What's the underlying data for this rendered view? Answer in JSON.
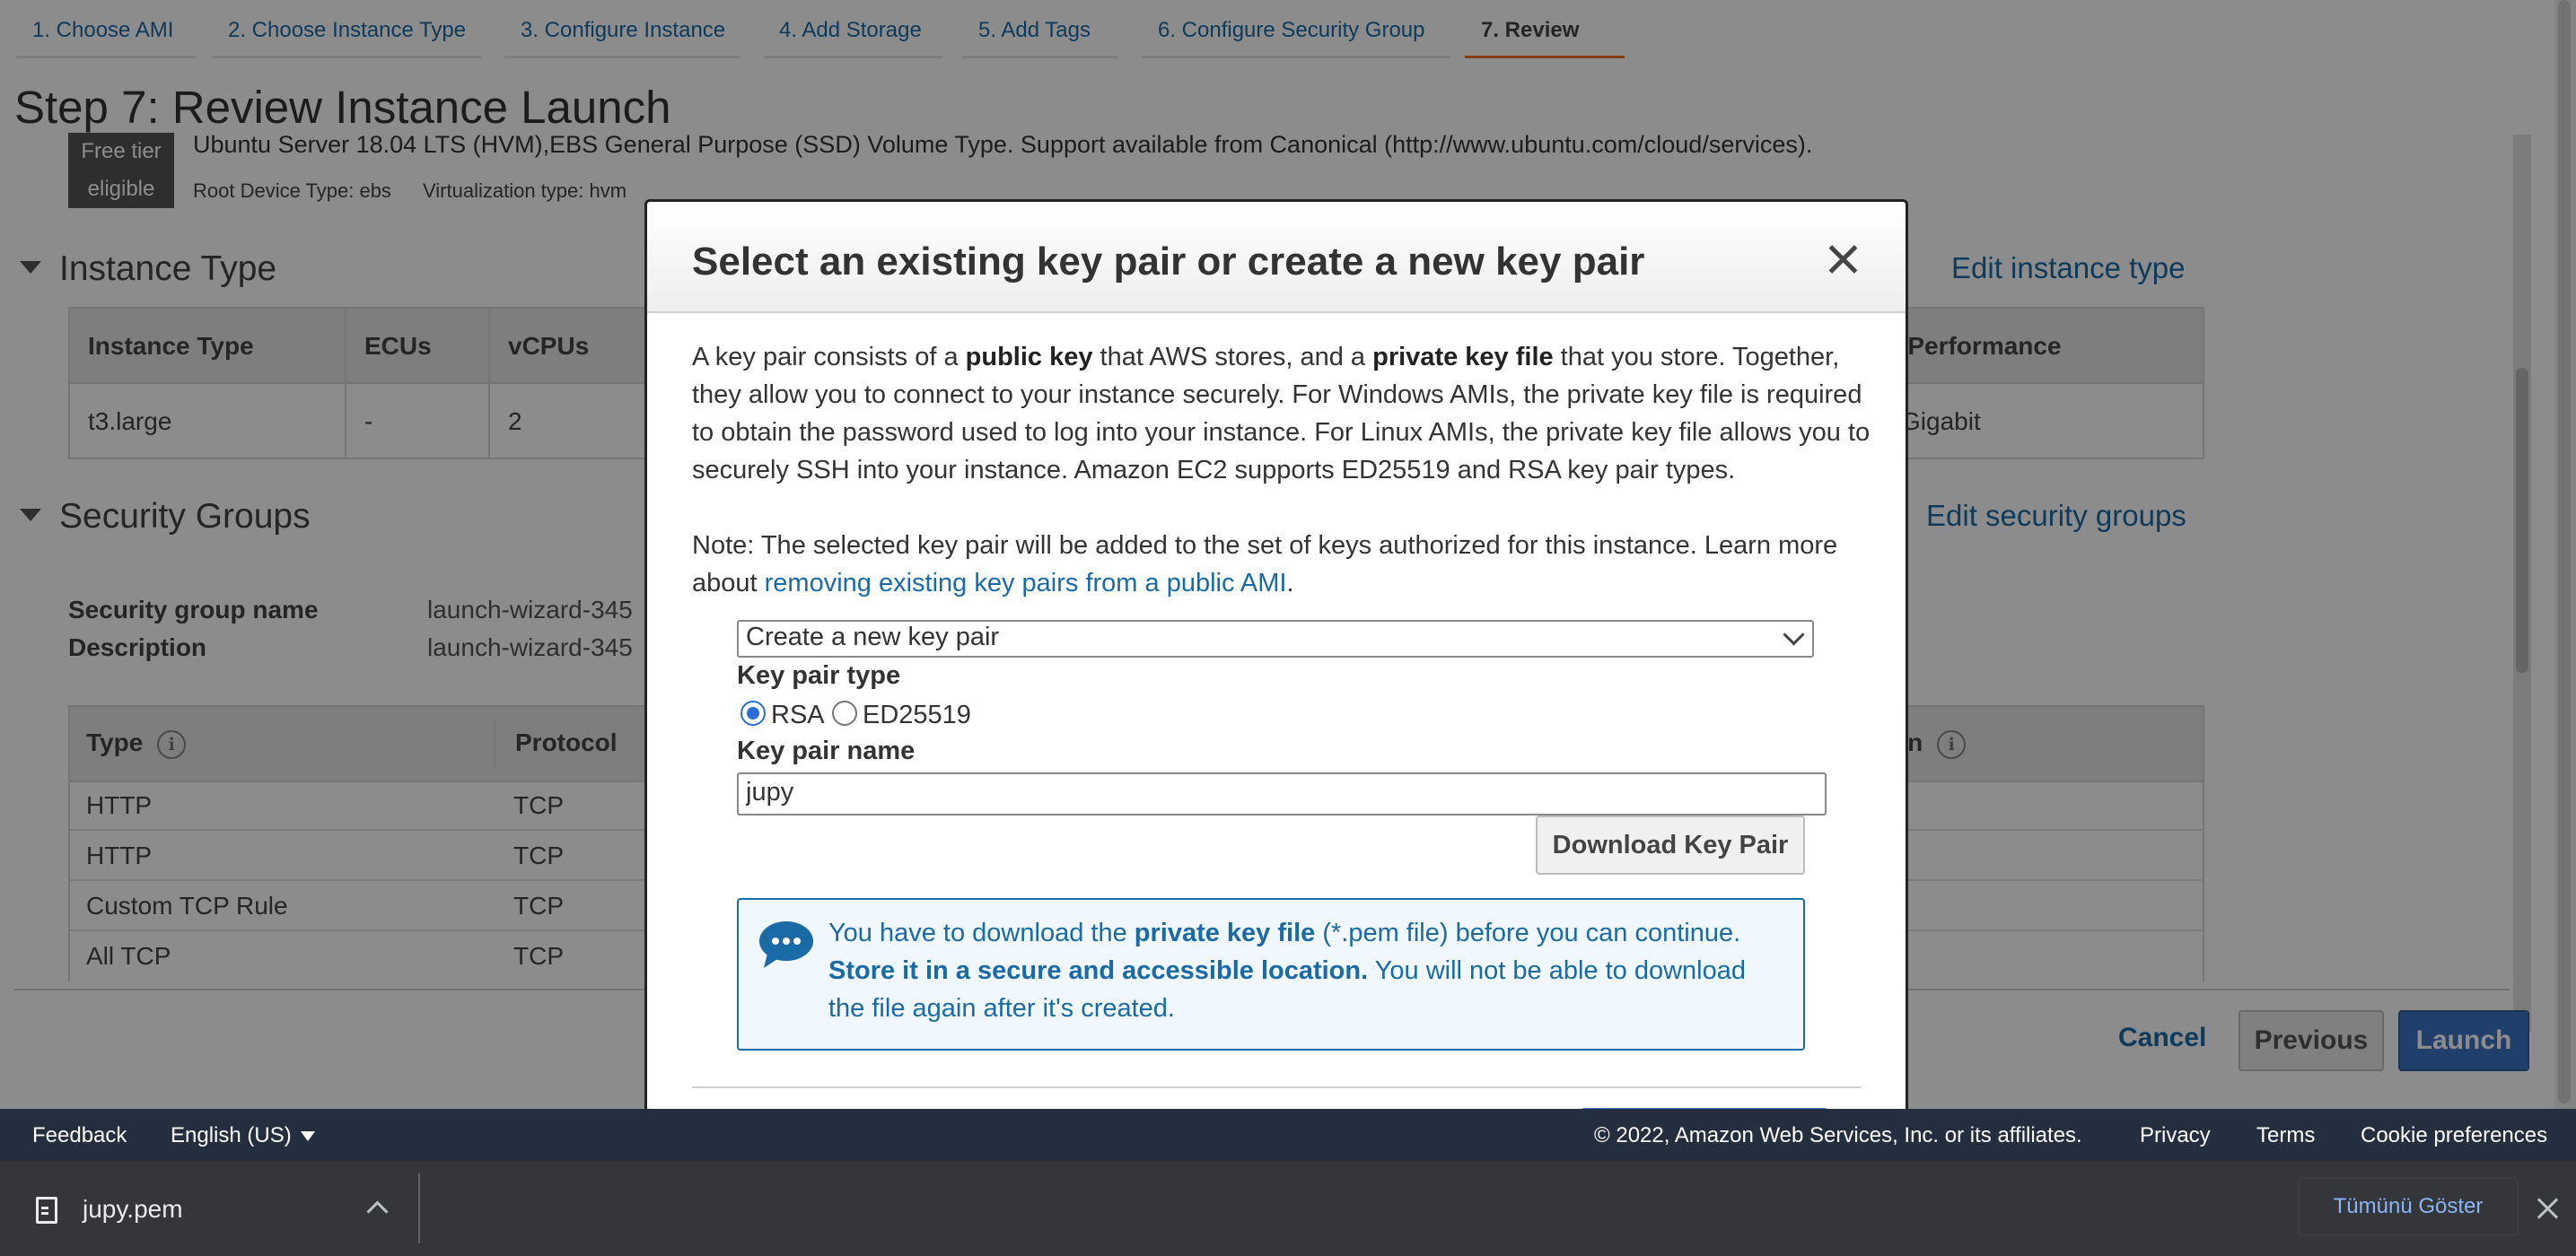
{
  "wizard": {
    "tabs": [
      {
        "label": "1. Choose AMI"
      },
      {
        "label": "2. Choose Instance Type"
      },
      {
        "label": "3. Configure Instance"
      },
      {
        "label": "4. Add Storage"
      },
      {
        "label": "5. Add Tags"
      },
      {
        "label": "6. Configure Security Group"
      },
      {
        "label": "7. Review"
      }
    ],
    "active_tab": "7. Review",
    "active_color": "#ec7211"
  },
  "page": {
    "title": "Step 7: Review Instance Launch",
    "ami": {
      "badge": [
        "Free tier",
        "eligible"
      ],
      "description": "Ubuntu Server 18.04 LTS (HVM),EBS General Purpose (SSD) Volume Type. Support available from Canonical (http://www.ubuntu.com/cloud/services).",
      "root_device": "Root Device Type: ebs",
      "virtualization": "Virtualization type: hvm"
    },
    "instance_type": {
      "heading": "Instance Type",
      "edit_link": "Edit instance type",
      "columns": [
        "Instance Type",
        "ECUs",
        "vCPUs",
        "k Performance"
      ],
      "row": [
        "t3.large",
        "-",
        "2",
        "Gigabit"
      ]
    },
    "security_groups": {
      "heading": "Security Groups",
      "edit_link": "Edit security groups",
      "name_key": "Security group name",
      "name_value": "launch-wizard-345",
      "desc_key": "Description",
      "desc_value": "launch-wizard-345",
      "columns": [
        "Type",
        "Protocol",
        "on"
      ],
      "rows": [
        [
          "HTTP",
          "TCP"
        ],
        [
          "HTTP",
          "TCP"
        ],
        [
          "Custom TCP Rule",
          "TCP"
        ],
        [
          "All TCP",
          "TCP"
        ]
      ]
    },
    "buttons": {
      "cancel": "Cancel",
      "previous": "Previous",
      "launch": "Launch"
    }
  },
  "modal": {
    "title": "Select an existing key pair or create a new key pair",
    "intro": {
      "p1": "A key pair consists of a ",
      "b1": "public key",
      "p2": " that AWS stores, and a ",
      "b2": "private key file",
      "p3": " that you store. Together, they allow you to connect to your instance securely. For Windows AMIs, the private key file is required to obtain the password used to log into your instance. For Linux AMIs, the private key file allows you to securely SSH into your instance. Amazon EC2 supports ED25519 and RSA key pair types."
    },
    "note": {
      "text": "Note: The selected key pair will be added to the set of keys authorized for this instance. Learn more about ",
      "link": "removing existing key pairs from a public AMI",
      "end": "."
    },
    "select_value": "Create a new key pair",
    "key_pair_type_label": "Key pair type",
    "radio_rsa": "RSA",
    "radio_ed": "ED25519",
    "key_pair_name_label": "Key pair name",
    "key_pair_name_value": "jupy",
    "download_button": "Download Key Pair",
    "alert": {
      "p1": "You have to download the ",
      "b1": "private key file",
      "p2": " (*.pem file) before you can continue. ",
      "b2": "Store it in a secure and accessible location.",
      "p3": " You will not be able to download the file again after it's created."
    }
  },
  "console_footer": {
    "feedback": "Feedback",
    "language": "English (US)",
    "copyright": "© 2022, Amazon Web Services, Inc. or its affiliates.",
    "privacy": "Privacy",
    "terms": "Terms",
    "cookies": "Cookie preferences"
  },
  "download_bar": {
    "file_name": "jupy.pem",
    "show_all": "Tümünü Göster"
  }
}
